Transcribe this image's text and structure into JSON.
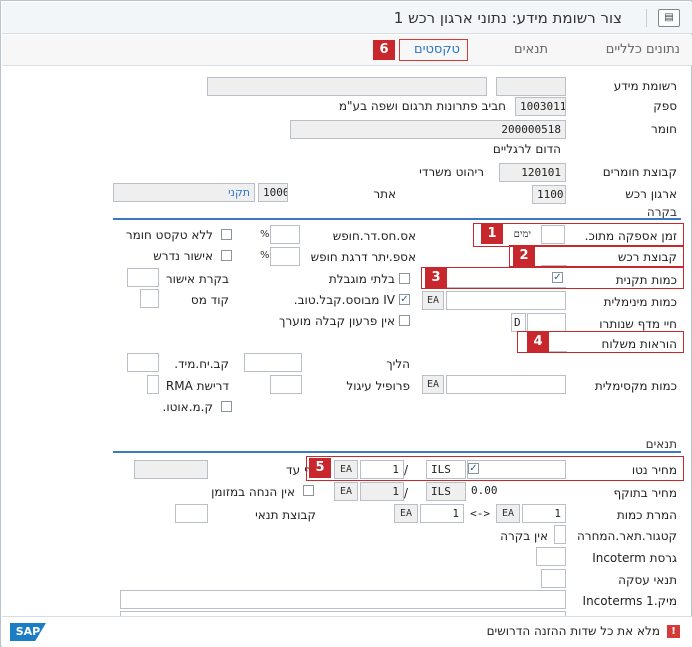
{
  "window": {
    "title": "צור רשומת מידע: נתוני ארגון רכש 1",
    "icon": "document-icon"
  },
  "tabs": [
    {
      "label": "נתונים כלליים"
    },
    {
      "label": "תנאים"
    },
    {
      "label": "טקסטים"
    }
  ],
  "header": {
    "info_record_label": "רשומת מידע",
    "info_record_value": "",
    "vendor_label": "ספק",
    "vendor_value": "1003011",
    "vendor_name": "חביב פתרונות תרגום ושפה בע\"מ",
    "material_label": "חומר",
    "material_value": "200000518",
    "material_desc": "הדום לרגליים",
    "matgroup_label": "קבוצת חומרים",
    "matgroup_value": "120101",
    "matgroup_desc": "ריהוט משרדי",
    "purch_org_label": "ארגון רכש",
    "purch_org_value": "1100",
    "plant_label": "אתר",
    "plant_value": "1000",
    "plant_desc": "תקני"
  },
  "control": {
    "title": "בקרה",
    "planned_delivery_label": "זמן אספקה מתוכ.",
    "planned_delivery_value": "",
    "planned_delivery_unit": "ימים",
    "purch_group_label": "קבוצת רכש",
    "purch_group_value": "",
    "std_qty_label": "כמות תקנית",
    "std_qty_value": "",
    "min_qty_label": "כמות מינימלית",
    "min_qty_value": "",
    "min_qty_unit": "EA",
    "rem_shelf_label": "חיי מדף שנותרו",
    "rem_shelf_value": "",
    "rem_shelf_unit": "D",
    "ship_instr_label": "הוראות משלוח",
    "ship_instr_value": "",
    "max_qty_label": "כמות מקסימלית",
    "max_qty_value": "",
    "max_qty_unit": "EA",
    "no_tol_label": "אס.חס.דר.חופש",
    "no_tol_value": "",
    "over_tol_label": "אספ.יתר דרגת חופש",
    "over_tol_value": "",
    "unlimited_label": "בלתי מוגבלת",
    "gr_based_label": "IV מבוסס.קבל.טוב.",
    "no_eval_label": "אין פרעון קבלה מוערך",
    "no_text_label": "ללא טקסט חומר",
    "ack_reqd_label": "אישור נדרש",
    "conf_ctrl_label": "בקרת אישור",
    "conf_ctrl_value": "",
    "tax_code_label": "קוד מס",
    "tax_code_value": "",
    "procedure_label": "הליך",
    "procedure_value": "",
    "rounding_label": "פרופיל עיגול",
    "rounding_value": "",
    "unit_measure_label": "קב.יח.מיד.",
    "unit_measure_value": "",
    "rma_label": "דרישת RMA",
    "rma_value": "",
    "auto_po_label": "ק.מ.אוטו."
  },
  "conditions": {
    "title": "תנאים",
    "net_price_label": "מחיר נטו",
    "net_price_value": "",
    "net_currency": "ILS",
    "net_per": "1",
    "net_unit": "EA",
    "valid_to_label": "תקף עד",
    "valid_to_value": "",
    "eff_price_label": "מחיר בתוקף",
    "eff_price_value": "0.00",
    "eff_currency": "ILS",
    "eff_per": "1",
    "eff_unit": "EA",
    "no_cash_label": "אין הנחה במזומן",
    "qty_conv_label": "המרת כמות",
    "qty_conv_left": "1",
    "qty_conv_left_unit": "EA",
    "qty_conv_arrow": "<->",
    "qty_conv_right": "1",
    "qty_conv_right_unit": "EA",
    "cond_group_label": "קבוצת תנאי",
    "cond_group_value": "",
    "price_date_label": "קטגור.תאר.המחרה",
    "price_date_value": "אין בקרה",
    "incoterm_ver_label": "גרסת Incoterm",
    "incoterm_ver_value": "",
    "terms_label": "תנאי עסקה",
    "terms_value": "",
    "incoterm_loc_label": "מיק.Incoterms 1",
    "incoterm_loc_value": ""
  },
  "status": {
    "message": "מלא את כל שדות ההזנה הדרושים",
    "logo": "SAP"
  },
  "callouts": [
    "1",
    "2",
    "3",
    "4",
    "5",
    "6"
  ],
  "colors": {
    "callout": "#c8282d",
    "accent": "#2b78c6",
    "section_line": "#3a7bbf"
  }
}
